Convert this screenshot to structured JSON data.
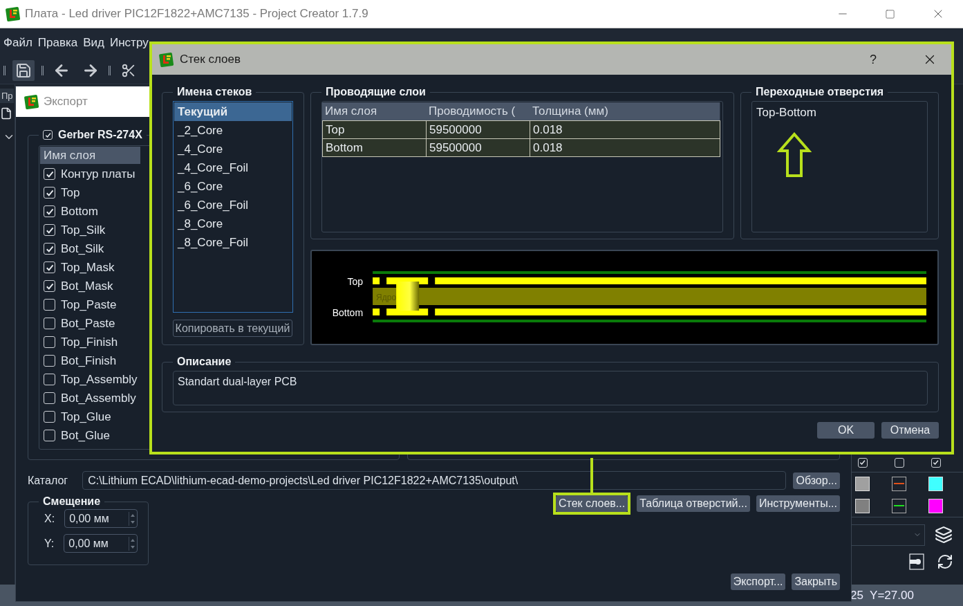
{
  "main_window": {
    "title": "Плата - Led driver PIC12F1822+AMC7135 - Project Creator 1.7.9",
    "menu": [
      "Файл",
      "Правка",
      "Вид",
      "Инстру"
    ],
    "left_tab": "Пр",
    "right_panel": {
      "checkboxes": [
        {
          "checked": true
        },
        {
          "checked": false
        },
        {
          "checked": true
        }
      ],
      "swatch_rows": [
        [
          {
            "kind": "fill",
            "color": "#a0a0a0"
          },
          {
            "kind": "line",
            "color": "#e0501a"
          },
          {
            "kind": "fill",
            "color": "#40ffff"
          }
        ],
        [
          {
            "kind": "fill",
            "color": "#808080"
          },
          {
            "kind": "line",
            "color": "#20e020"
          },
          {
            "kind": "fill",
            "color": "#ff00ff"
          }
        ]
      ]
    },
    "status_text": "25  Y=27.00"
  },
  "export_dialog": {
    "title": "Экспорт",
    "format": {
      "label": "Gerber RS-274X",
      "checked": true
    },
    "layer_table": {
      "columns": [
        "Имя слоя"
      ],
      "rows": [
        {
          "name": "Контур платы",
          "checked": true
        },
        {
          "name": "Top",
          "checked": true
        },
        {
          "name": "Bottom",
          "checked": true
        },
        {
          "name": "Top_Silk",
          "checked": true
        },
        {
          "name": "Bot_Silk",
          "checked": true
        },
        {
          "name": "Top_Mask",
          "checked": true
        },
        {
          "name": "Bot_Mask",
          "checked": true
        },
        {
          "name": "Top_Paste",
          "checked": false
        },
        {
          "name": "Bot_Paste",
          "checked": false
        },
        {
          "name": "Top_Finish",
          "checked": false
        },
        {
          "name": "Bot_Finish",
          "checked": false
        },
        {
          "name": "Top_Assembly",
          "checked": false
        },
        {
          "name": "Bot_Assembly",
          "checked": false
        },
        {
          "name": "Top_Glue",
          "checked": false
        },
        {
          "name": "Bot_Glue",
          "checked": false
        }
      ]
    },
    "catalog": {
      "label": "Каталог",
      "value": "C:\\Lithium ECAD\\lithium-ecad-demo-projects\\Led driver PIC12F1822+AMC7135\\output\\"
    },
    "browse_button": "Обзор...",
    "offset": {
      "title": "Смещение",
      "fields": [
        {
          "label": "X:",
          "value": "0,00 мм"
        },
        {
          "label": "Y:",
          "value": "0,00 мм"
        }
      ]
    },
    "tool_buttons": [
      {
        "label": "Стек слоев...",
        "highlighted": true
      },
      {
        "label": "Таблица отверстий...",
        "highlighted": false
      },
      {
        "label": "Инструменты...",
        "highlighted": false
      }
    ],
    "footer_buttons": [
      "Экспорт...",
      "Закрыть"
    ]
  },
  "stack_dialog": {
    "title": "Стек слоев",
    "help": "?",
    "stacks": {
      "title": "Имена стеков",
      "items": [
        {
          "label": "Текущий",
          "selected": true
        },
        {
          "label": "_2_Core",
          "selected": false
        },
        {
          "label": "_4_Core",
          "selected": false
        },
        {
          "label": "_4_Core_Foil",
          "selected": false
        },
        {
          "label": "_6_Core",
          "selected": false
        },
        {
          "label": "_6_Core_Foil",
          "selected": false
        },
        {
          "label": "_8_Core",
          "selected": false
        },
        {
          "label": "_8_Core_Foil",
          "selected": false
        }
      ],
      "copy_button": "Копировать в текущий"
    },
    "conductive": {
      "title": "Проводящие слои",
      "columns": [
        "Имя слоя",
        "Проводимость (",
        "Толщина (мм)"
      ],
      "rows": [
        [
          "Top",
          "59500000",
          "0.018"
        ],
        [
          "Bottom",
          "59500000",
          "0.018"
        ]
      ]
    },
    "vias": {
      "title": "Переходные отверстия",
      "items": [
        "Top-Bottom"
      ]
    },
    "stackup": {
      "layer_labels": [
        "Top",
        "Bottom"
      ],
      "core_label": "Ядро"
    },
    "description": {
      "title": "Описание",
      "value": "Standart dual-layer PCB"
    },
    "buttons": [
      "OK",
      "Отмена"
    ]
  }
}
